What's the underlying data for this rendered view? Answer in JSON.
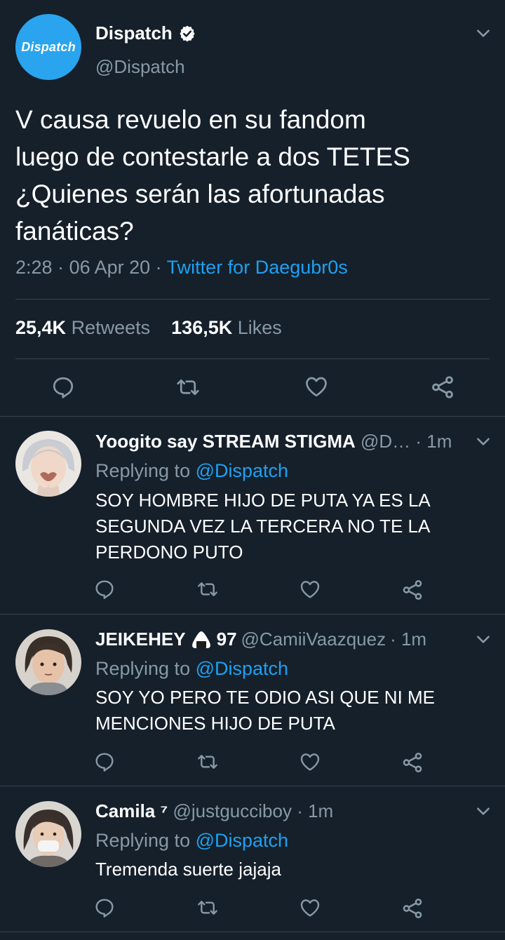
{
  "main_tweet": {
    "avatar_text": "Dispatch",
    "name": "Dispatch",
    "handle": "@Dispatch",
    "text": "V causa revuelo en su fandom\nluego de contestarle a dos TETES\n¿Quienes serán las afortunadas\nfanáticas?",
    "time": "2:28",
    "date": "06 Apr 20",
    "separator": " · ",
    "source": "Twitter for Daegubr0s",
    "retweets_count": "25,4K",
    "retweets_label": "Retweets",
    "likes_count": "136,5K",
    "likes_label": "Likes"
  },
  "replies": [
    {
      "name": "Yoogito say STREAM STIGMA",
      "handle": "@D…",
      "time": "· 1m",
      "replying_prefix": "Replying to ",
      "replying_to": "@Dispatch",
      "text": "SOY HOMBRE HIJO DE PUTA YA ES LA\nSEGUNDA VEZ LA TERCERA NO TE LA\nPERDONO PUTO"
    },
    {
      "name": "JEIKEHEY",
      "name_suffix": "97",
      "handle": "@CamiiVaazquez",
      "time": "· 1m",
      "replying_prefix": "Replying to ",
      "replying_to": "@Dispatch",
      "text": "SOY YO PERO TE ODIO ASI QUE NI ME\nMENCIONES HIJO DE PUTA"
    },
    {
      "name": "Camila",
      "name_suffix": "⁷",
      "handle": "@justgucciboy",
      "time": "· 1m",
      "replying_prefix": "Replying to ",
      "replying_to": "@Dispatch",
      "text": "Tremenda suerte jajaja"
    }
  ],
  "icons": [
    "verified-badge-icon",
    "chevron-down-icon",
    "reply-icon",
    "retweet-icon",
    "like-icon",
    "share-icon",
    "onigiri-emoji-icon"
  ],
  "colors": {
    "background": "#15202b",
    "accent": "#1da1f2",
    "muted": "#8899a6",
    "divider": "#38444d"
  }
}
